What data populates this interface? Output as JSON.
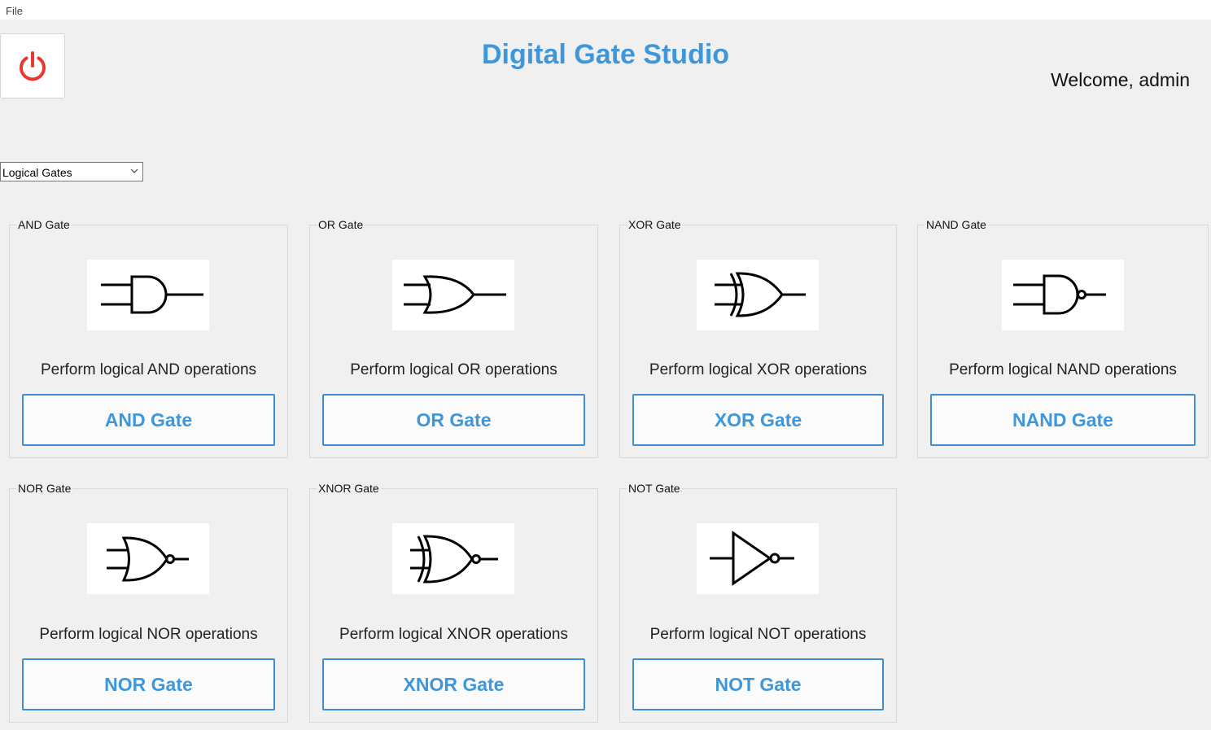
{
  "menu": {
    "file": "File"
  },
  "header": {
    "title": "Digital Gate Studio",
    "welcome": "Welcome, admin"
  },
  "category": {
    "selected": "Logical Gates"
  },
  "colors": {
    "accent": "#3d97da",
    "power": "#e8382f"
  },
  "gates": {
    "and": {
      "legend": "AND Gate",
      "description": "Perform logical AND operations",
      "button": "AND Gate"
    },
    "or": {
      "legend": "OR Gate",
      "description": "Perform logical OR operations",
      "button": "OR Gate"
    },
    "xor": {
      "legend": "XOR Gate",
      "description": "Perform logical XOR operations",
      "button": "XOR Gate"
    },
    "nand": {
      "legend": "NAND Gate",
      "description": "Perform logical NAND operations",
      "button": "NAND Gate"
    },
    "nor": {
      "legend": "NOR Gate",
      "description": "Perform logical NOR operations",
      "button": "NOR Gate"
    },
    "xnor": {
      "legend": "XNOR Gate",
      "description": "Perform logical XNOR operations",
      "button": "XNOR Gate"
    },
    "not": {
      "legend": "NOT Gate",
      "description": "Perform logical NOT operations",
      "button": "NOT Gate"
    }
  }
}
